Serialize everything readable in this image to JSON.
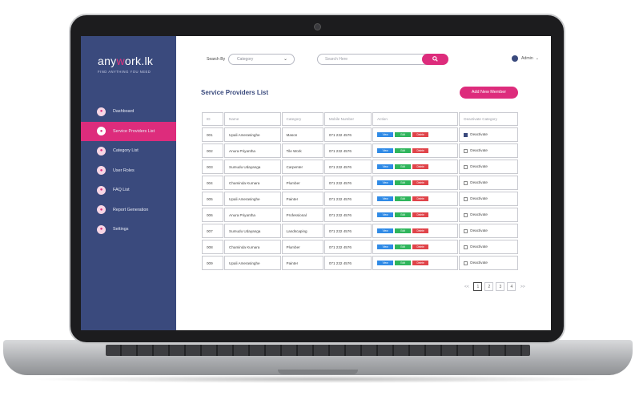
{
  "brand": {
    "logo_pre": "any",
    "logo_mid": "w",
    "logo_post": "ork.lk",
    "tagline": "FIND ANYTHING YOU NEED",
    "accent": "#dd2c7c",
    "sidebar_color": "#3a4a7d"
  },
  "sidebar": {
    "items": [
      {
        "label": "Dashboard",
        "icon": "dashboard-icon",
        "active": false
      },
      {
        "label": "Service Providers List",
        "icon": "service-providers-icon",
        "active": true
      },
      {
        "label": "Category List",
        "icon": "category-icon",
        "active": false
      },
      {
        "label": "User Roles",
        "icon": "user-roles-icon",
        "active": false
      },
      {
        "label": "FAQ List",
        "icon": "faq-icon",
        "active": false
      },
      {
        "label": "Report Generation",
        "icon": "report-icon",
        "active": false
      },
      {
        "label": "Settings",
        "icon": "settings-icon",
        "active": false
      }
    ]
  },
  "topbar": {
    "search_by_label": "Search By",
    "category_placeholder": "Category",
    "search_placeholder": "Search Here",
    "user_label": "Admin"
  },
  "main": {
    "title": "Service Providers List",
    "add_button": "Add New Member",
    "columns": [
      "ID",
      "Name",
      "Category",
      "Mobile Number",
      "Action",
      "Deactivate Category"
    ],
    "action_labels": {
      "view": "View",
      "edit": "Edit",
      "delete": "Delete"
    },
    "deactivate_label": "Deactivate",
    "rows": [
      {
        "id": "001",
        "name": "Upali Amerasinghe",
        "category": "Mason",
        "mobile": "071 232 4576",
        "checked": true
      },
      {
        "id": "002",
        "name": "Anura Priyantha",
        "category": "Tile Work",
        "mobile": "071 232 4576",
        "checked": false
      },
      {
        "id": "003",
        "name": "Sumudu Udayanga",
        "category": "Carpenter",
        "mobile": "071 232 4576",
        "checked": false
      },
      {
        "id": "004",
        "name": "Chaminda Kumara",
        "category": "Plumber",
        "mobile": "071 232 4576",
        "checked": false
      },
      {
        "id": "005",
        "name": "Upali Amerasinghe",
        "category": "Painter",
        "mobile": "071 232 4576",
        "checked": false
      },
      {
        "id": "006",
        "name": "Anura Priyantha",
        "category": "Professional",
        "mobile": "071 232 4576",
        "checked": false
      },
      {
        "id": "007",
        "name": "Sumudu Udayanga",
        "category": "Landscaping",
        "mobile": "071 232 4576",
        "checked": false
      },
      {
        "id": "008",
        "name": "Chaminda Kumara",
        "category": "Plumber",
        "mobile": "071 232 4576",
        "checked": false
      },
      {
        "id": "009",
        "name": "Upali Amerasinghe",
        "category": "Painter",
        "mobile": "071 232 4576",
        "checked": false
      }
    ]
  },
  "pagination": {
    "prev": "<<",
    "pages": [
      "1",
      "2",
      "3",
      "4"
    ],
    "current": "1",
    "next": ">>"
  }
}
